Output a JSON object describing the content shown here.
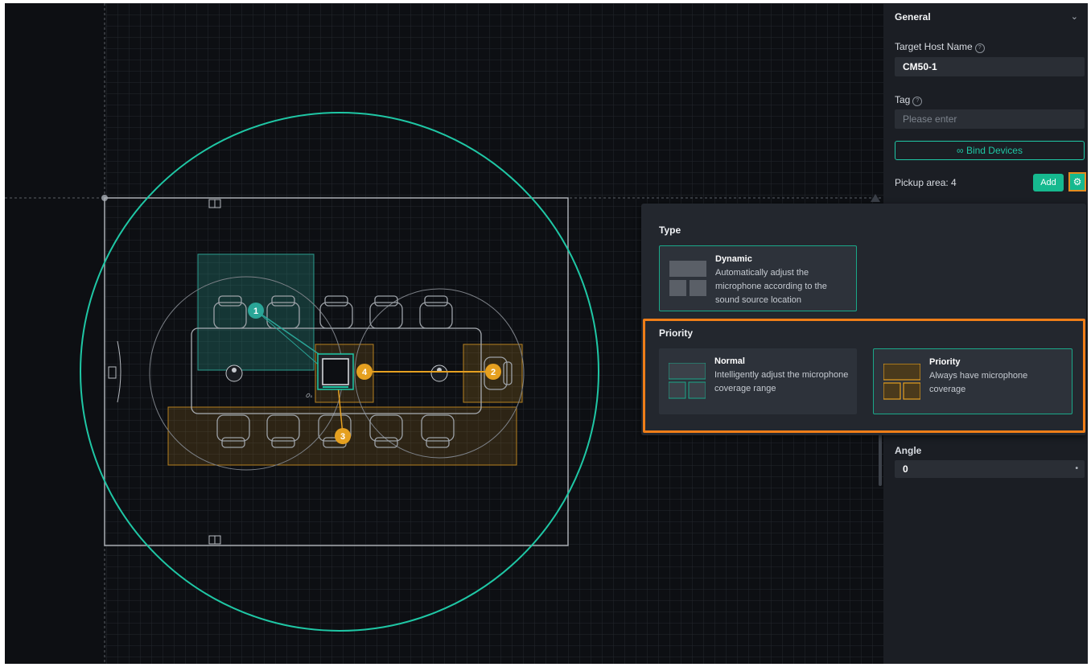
{
  "panel": {
    "section_title": "General",
    "target_host_label": "Target Host Name",
    "target_host_value": "CM50-1",
    "tag_label": "Tag",
    "tag_placeholder": "Please enter",
    "bind_devices_label": "Bind Devices",
    "pickup_area_label": "Pickup area: 4",
    "add_label": "Add",
    "angle_label": "Angle",
    "angle_value": "0"
  },
  "popup": {
    "type_title": "Type",
    "type_option": {
      "title": "Dynamic",
      "description": "Automatically adjust the microphone according to the sound source location"
    },
    "priority_title": "Priority",
    "priority_options": [
      {
        "title": "Normal",
        "description": "Intelligently adjust the microphone coverage range"
      },
      {
        "title": "Priority",
        "description": "Always have microphone coverage"
      }
    ]
  },
  "canvas": {
    "pickup_markers": [
      "1",
      "2",
      "3",
      "4"
    ],
    "colors": {
      "coverage_ring": "#1fc7a5",
      "area_dynamic": "#2a9d8f",
      "area_priority": "#e5a020",
      "highlight": "#ef7e18"
    }
  },
  "icons": [
    "chevron-down-icon",
    "help-icon",
    "link-icon",
    "gear-icon",
    "dropdown-caret-icon"
  ]
}
